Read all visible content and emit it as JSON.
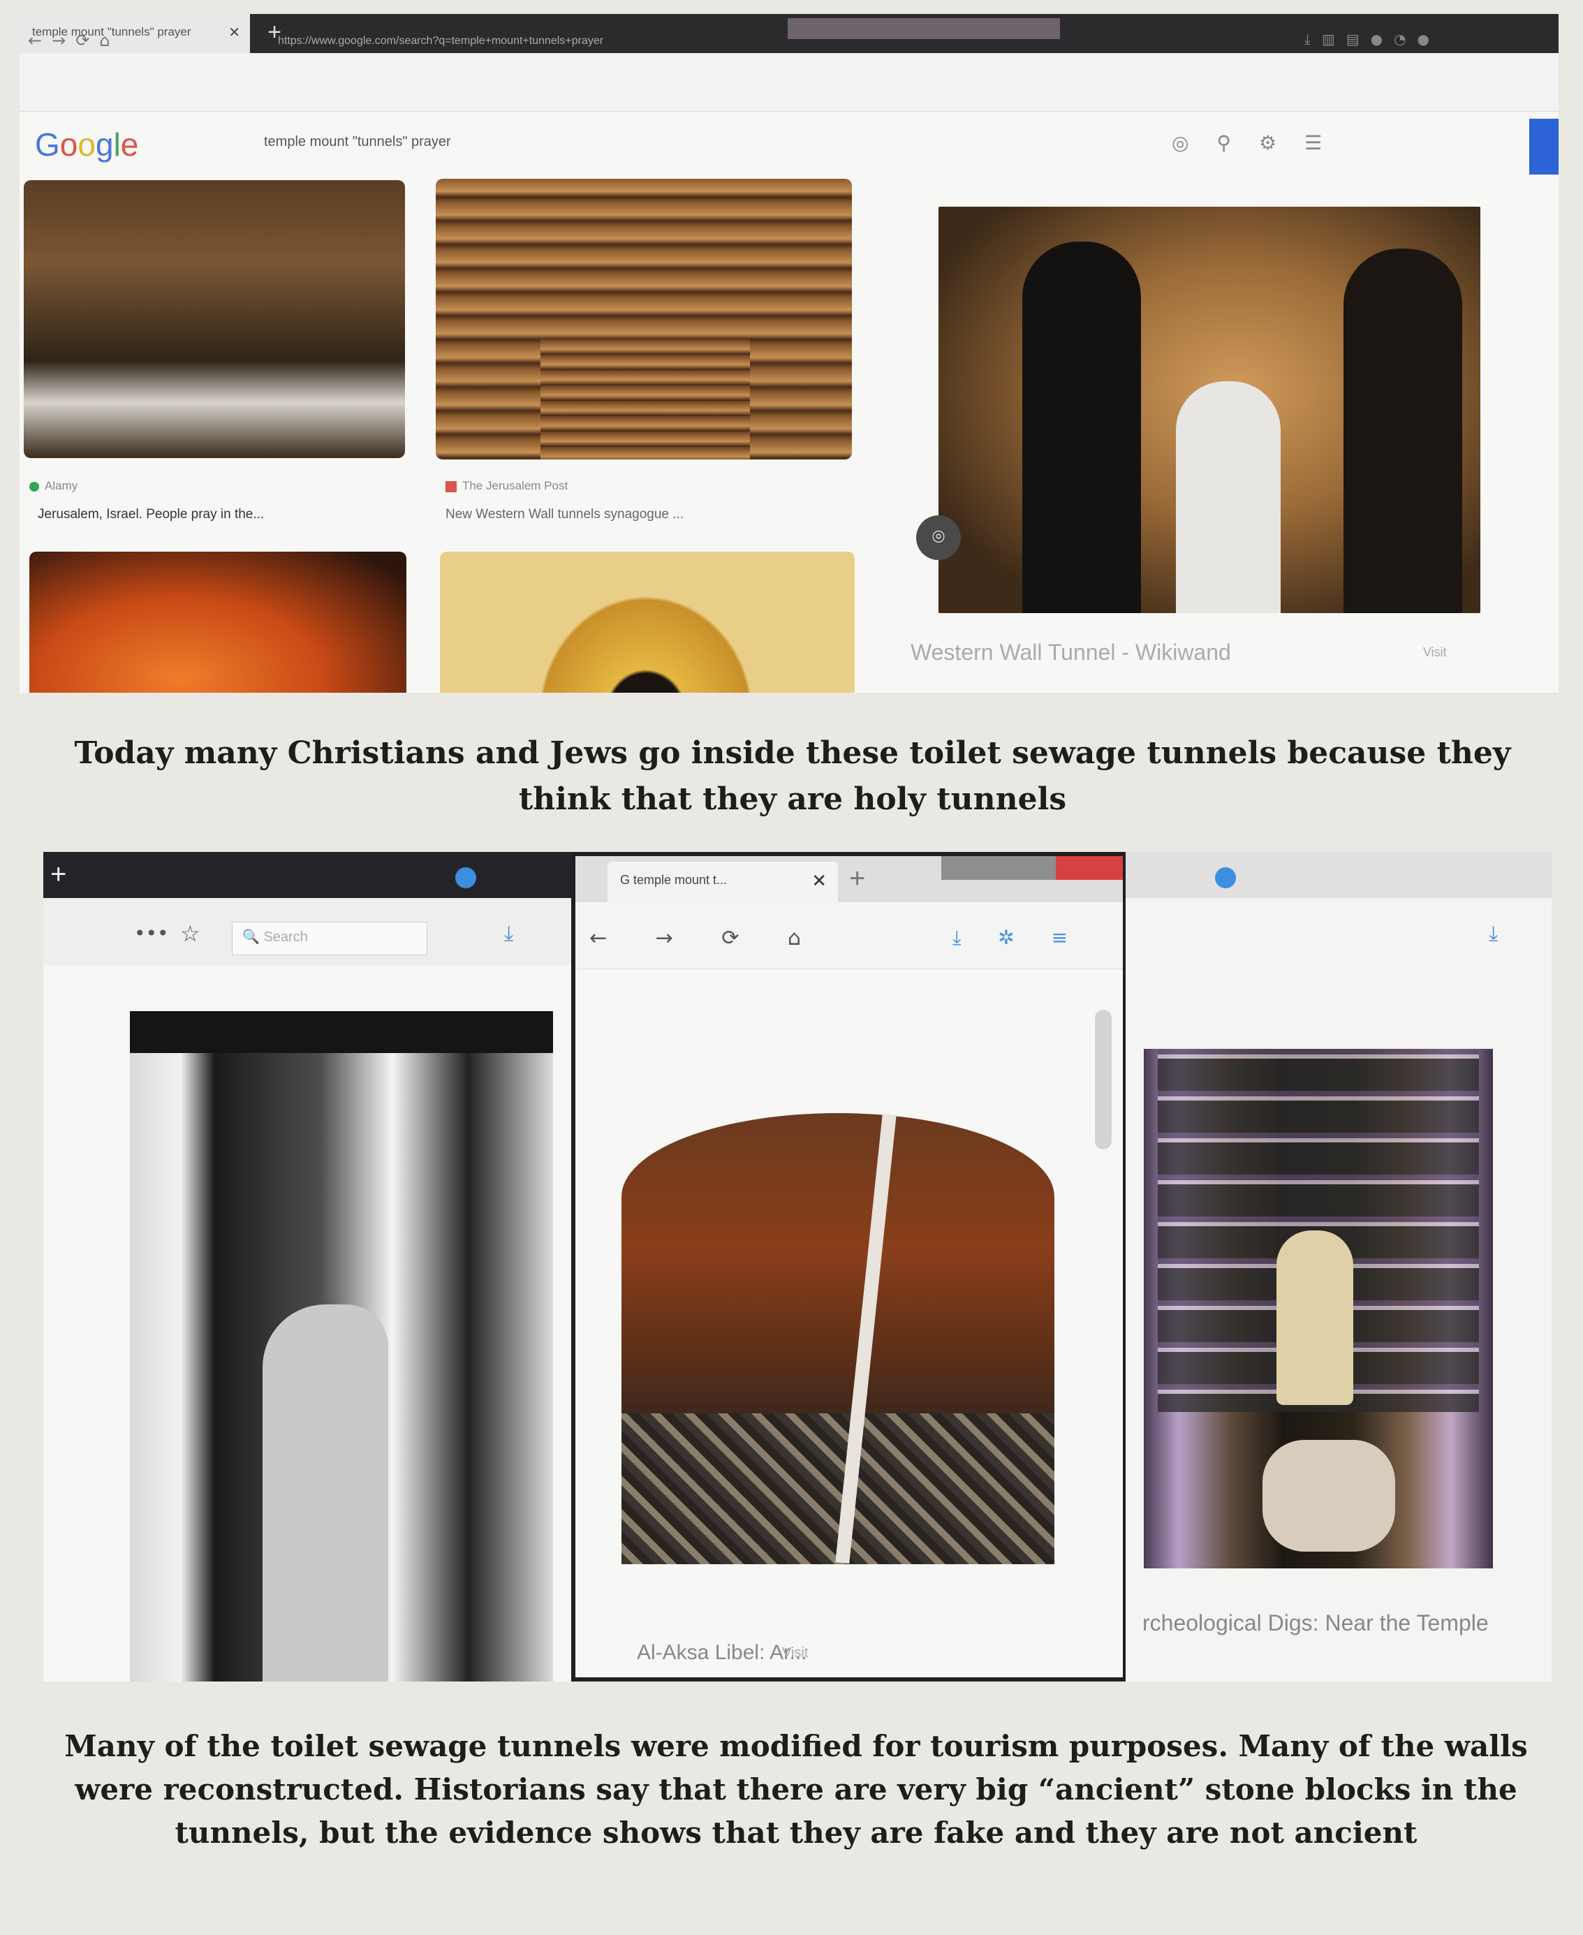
{
  "top_screenshot": {
    "browser_tab": "temple mount \"tunnels\" prayer",
    "tab_close": "✕",
    "new_tab": "+",
    "url": "https://www.google.com/search?q=temple+mount+tunnels+prayer",
    "search_logo": [
      "G",
      "o",
      "o",
      "g",
      "l",
      "e"
    ],
    "search_query": "temple mount \"tunnels\" prayer",
    "results": [
      {
        "source": "Alamy",
        "caption": "Jerusalem, Israel. People pray in the..."
      },
      {
        "source": "The Jerusalem Post",
        "caption": "New Western Wall tunnels synagogue ..."
      }
    ],
    "preview_title": "Western Wall Tunnel - Wikiwand",
    "preview_visit": "Visit",
    "lens_icon": "⌾"
  },
  "caption_top": "Today many Christians and Jews go inside these toilet sewage tunnels because they think that they are holy tunnels",
  "bottom_screenshots": {
    "left": {
      "plus": "+",
      "dots": "•••",
      "star": "☆",
      "search_placeholder": "🔍 Search",
      "download": "⤓"
    },
    "middle": {
      "tab_label": "G  temple mount t...",
      "tab_close": "✕",
      "new_tab": "+",
      "nav": "← → ⟳ ⌂",
      "right_icons": "⤓ ✲ ≡",
      "result_title": "Al-Aksa Libel: Ar...",
      "visit": "Visit"
    },
    "right": {
      "download": "⤓",
      "result_title": "rcheological Digs: Near the Temple"
    }
  },
  "caption_bottom": "Many of the toilet sewage tunnels were modified for tourism purposes. Many of the walls were reconstructed. Historians say that there are very big “ancient” stone blocks in the tunnels, but the evidence shows that they are fake and they are not ancient"
}
